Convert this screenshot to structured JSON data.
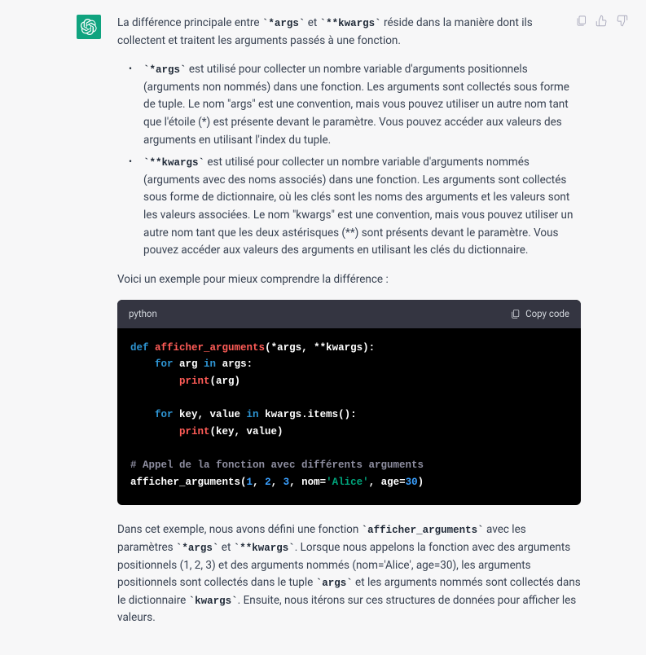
{
  "message": {
    "intro_pre": "La différence principale entre ",
    "code_args": "`*args`",
    "intro_mid": " et ",
    "code_kwargs": "`**kwargs`",
    "intro_post": " réside dans la manière dont ils collectent et traitent les arguments passés à une fonction.",
    "bullets": [
      {
        "code": "`*args`",
        "text": " est utilisé pour collecter un nombre variable d'arguments positionnels (arguments non nommés) dans une fonction. Les arguments sont collectés sous forme de tuple. Le nom \"args\" est une convention, mais vous pouvez utiliser un autre nom tant que l'étoile (*) est présente devant le paramètre. Vous pouvez accéder aux valeurs des arguments en utilisant l'index du tuple."
      },
      {
        "code": "`**kwargs`",
        "text": " est utilisé pour collecter un nombre variable d'arguments nommés (arguments avec des noms associés) dans une fonction. Les arguments sont collectés sous forme de dictionnaire, où les clés sont les noms des arguments et les valeurs sont les valeurs associées. Le nom \"kwargs\" est une convention, mais vous pouvez utiliser un autre nom tant que les deux astérisques (**) sont présents devant le paramètre. Vous pouvez accéder aux valeurs des arguments en utilisant les clés du dictionnaire."
      }
    ],
    "example_intro": "Voici un exemple pour mieux comprendre la différence :",
    "codeblock": {
      "lang": "python",
      "copy_label": "Copy code",
      "tokens": [
        [
          [
            "kw",
            "def"
          ],
          [
            "pn",
            " "
          ],
          [
            "fn",
            "afficher_arguments"
          ],
          [
            "pn",
            "(*args, **kwargs):"
          ]
        ],
        [
          [
            "pn",
            "    "
          ],
          [
            "kw",
            "for"
          ],
          [
            "pn",
            " arg "
          ],
          [
            "kw",
            "in"
          ],
          [
            "pn",
            " args:"
          ]
        ],
        [
          [
            "pn",
            "        "
          ],
          [
            "fn",
            "print"
          ],
          [
            "pn",
            "(arg)"
          ]
        ],
        [],
        [
          [
            "pn",
            "    "
          ],
          [
            "kw",
            "for"
          ],
          [
            "pn",
            " key, value "
          ],
          [
            "kw",
            "in"
          ],
          [
            "pn",
            " kwargs.items():"
          ]
        ],
        [
          [
            "pn",
            "        "
          ],
          [
            "fn",
            "print"
          ],
          [
            "pn",
            "(key, value)"
          ]
        ],
        [],
        [
          [
            "cmt",
            "# Appel de la fonction avec différents arguments"
          ]
        ],
        [
          [
            "pn",
            "afficher_arguments("
          ],
          [
            "num",
            "1"
          ],
          [
            "pn",
            ", "
          ],
          [
            "num",
            "2"
          ],
          [
            "pn",
            ", "
          ],
          [
            "num",
            "3"
          ],
          [
            "pn",
            ", nom="
          ],
          [
            "str",
            "'Alice'"
          ],
          [
            "pn",
            ", age="
          ],
          [
            "num",
            "30"
          ],
          [
            "pn",
            ")"
          ]
        ]
      ]
    },
    "outro": {
      "p1a": "Dans cet exemple, nous avons défini une fonction ",
      "c1": "`afficher_arguments`",
      "p1b": " avec les paramètres ",
      "c2": "`*args`",
      "p1c": " et ",
      "c3": "`**kwargs`",
      "p1d": ". Lorsque nous appelons la fonction avec des arguments positionnels (1, 2, 3) et des arguments nommés (nom='Alice', age=30), les arguments positionnels sont collectés dans le tuple ",
      "c4": "`args`",
      "p1e": " et les arguments nommés sont collectés dans le dictionnaire ",
      "c5": "`kwargs`",
      "p1f": ". Ensuite, nous itérons sur ces structures de données pour afficher les valeurs."
    }
  }
}
